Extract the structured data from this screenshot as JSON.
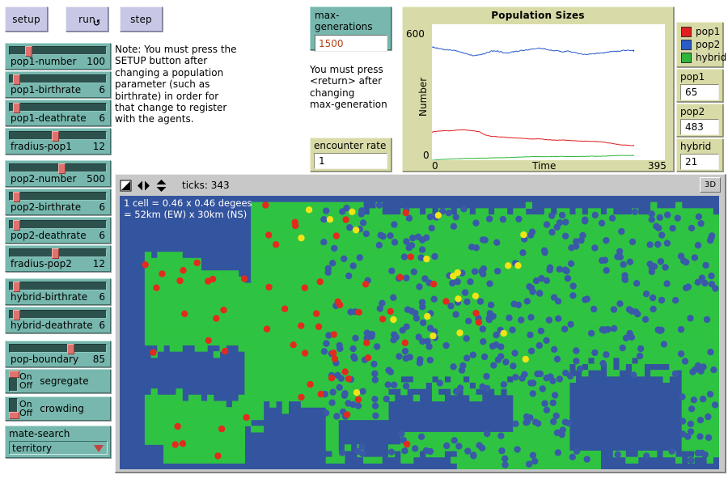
{
  "buttons": [
    {
      "name": "setup",
      "label": "setup",
      "forever": false
    },
    {
      "name": "run",
      "label": "run",
      "forever": true,
      "icon": "forever-loop-icon"
    },
    {
      "name": "step",
      "label": "step",
      "forever": false
    }
  ],
  "note": {
    "text": "Note: You must press the SETUP button after changing a population parameter (such as birthrate) in order for that change to register with the agents."
  },
  "note2": {
    "text": "You must press\n<return> after\nchanging\nmax-generation"
  },
  "sliders": [
    {
      "name": "pop1-number",
      "label": "pop1-number",
      "value": "100",
      "fill": 0.16
    },
    {
      "name": "pop1-birthrate",
      "label": "pop1-birthrate",
      "value": "6",
      "fill": 0.03
    },
    {
      "name": "pop1-deathrate",
      "label": "pop1-deathrate",
      "value": "6",
      "fill": 0.03
    },
    {
      "name": "fradius-pop1",
      "label": "fradius-pop1",
      "value": "12",
      "fill": 0.44
    },
    {
      "name": "pop2-number",
      "label": "pop2-number",
      "value": "500",
      "fill": 0.5
    },
    {
      "name": "pop2-birthrate",
      "label": "pop2-birthrate",
      "value": "6",
      "fill": 0.03
    },
    {
      "name": "pop2-deathrate",
      "label": "pop2-deathrate",
      "value": "6",
      "fill": 0.03
    },
    {
      "name": "fradius-pop2",
      "label": "fradius-pop2",
      "value": "12",
      "fill": 0.44
    },
    {
      "name": "hybrid-birthrate",
      "label": "hybrid-birthrate",
      "value": "6",
      "fill": 0.03
    },
    {
      "name": "hybrid-deathrate",
      "label": "hybrid-deathrate",
      "value": "6",
      "fill": 0.03
    },
    {
      "name": "pop-boundary",
      "label": "pop-boundary",
      "value": "85",
      "fill": 0.6
    }
  ],
  "switches": [
    {
      "name": "segregate",
      "label": "segregate",
      "on_label": "On",
      "off_label": "Off",
      "state": "on"
    },
    {
      "name": "crowding",
      "label": "crowding",
      "on_label": "On",
      "off_label": "Off",
      "state": "off"
    }
  ],
  "chooser": {
    "name": "mate-search",
    "title": "mate-search",
    "value": "territory",
    "arrow_icon": "chevron-down-icon"
  },
  "max_generations": {
    "title": "max-generations",
    "value": "1500"
  },
  "encounter_rate": {
    "title": "encounter rate",
    "value": "1"
  },
  "monitors": [
    {
      "name": "pop1",
      "title": "pop1",
      "value": "65"
    },
    {
      "name": "pop2",
      "title": "pop2",
      "value": "483"
    },
    {
      "name": "hybrid",
      "title": "hybrid",
      "value": "21"
    }
  ],
  "legend": [
    {
      "label": "pop1",
      "color": "#E02020"
    },
    {
      "label": "pop2",
      "color": "#2A5BC8"
    },
    {
      "label": "hybrid",
      "color": "#2FB53C"
    }
  ],
  "view": {
    "ticks_label": "ticks: 343",
    "button_3d": "3D",
    "overlay_text": "1 cell = 0.46 x 0.46 degees\n= 52km (EW) x 30km (NS)",
    "icons": [
      "speed-slider-icon",
      "horizontal-wrap-icon",
      "vertical-wrap-icon"
    ],
    "land_color": "#2FC342",
    "water_color": "#33549E",
    "agent_colors": {
      "pop1": "#E22B1E",
      "pop2": "#3A59A8",
      "hybrid": "#F2E316"
    }
  },
  "chart_data": {
    "type": "line",
    "title": "Population Sizes",
    "xlabel": "Time",
    "ylabel": "Number",
    "xlim": [
      0,
      395
    ],
    "ylim": [
      0,
      600
    ],
    "xticks": [
      "0",
      "395"
    ],
    "yticks": [
      "0",
      "600"
    ],
    "grid": false,
    "legend_position": "right-outside",
    "series": [
      {
        "name": "pop1",
        "color": "#E02020",
        "x": [
          0,
          10,
          20,
          30,
          40,
          50,
          60,
          70,
          80,
          90,
          100,
          110,
          120,
          130,
          140,
          150,
          160,
          170,
          180,
          190,
          200,
          210,
          220,
          230,
          240,
          250,
          260,
          270,
          280,
          290,
          300,
          310,
          320,
          330,
          340,
          343
        ],
        "values": [
          124,
          128,
          131,
          130,
          132,
          134,
          133,
          130,
          126,
          112,
          106,
          104,
          102,
          100,
          99,
          97,
          95,
          93,
          95,
          92,
          90,
          88,
          89,
          88,
          86,
          85,
          84,
          83,
          82,
          80,
          76,
          72,
          68,
          66,
          65,
          65
        ]
      },
      {
        "name": "pop2",
        "color": "#2A5BC8",
        "x": [
          0,
          10,
          20,
          30,
          40,
          50,
          60,
          70,
          80,
          90,
          100,
          110,
          120,
          130,
          140,
          150,
          160,
          170,
          180,
          190,
          200,
          210,
          220,
          230,
          240,
          250,
          260,
          270,
          280,
          290,
          300,
          310,
          320,
          330,
          340,
          343
        ],
        "values": [
          500,
          494,
          489,
          486,
          483,
          477,
          468,
          462,
          466,
          470,
          481,
          483,
          476,
          474,
          479,
          483,
          487,
          490,
          494,
          492,
          487,
          483,
          479,
          481,
          476,
          470,
          466,
          468,
          472,
          474,
          478,
          480,
          482,
          486,
          484,
          483
        ]
      },
      {
        "name": "hybrid",
        "color": "#2FB53C",
        "x": [
          0,
          10,
          20,
          30,
          40,
          50,
          60,
          70,
          80,
          90,
          100,
          110,
          120,
          130,
          140,
          150,
          160,
          170,
          180,
          190,
          200,
          210,
          220,
          230,
          240,
          250,
          260,
          270,
          280,
          290,
          300,
          310,
          320,
          330,
          340,
          343
        ],
        "values": [
          0,
          2,
          4,
          5,
          6,
          7,
          8,
          8,
          9,
          9,
          10,
          11,
          11,
          12,
          13,
          14,
          15,
          16,
          16,
          15,
          16,
          16,
          17,
          16,
          16,
          17,
          17,
          18,
          17,
          18,
          19,
          20,
          21,
          21,
          21,
          21
        ]
      }
    ]
  }
}
